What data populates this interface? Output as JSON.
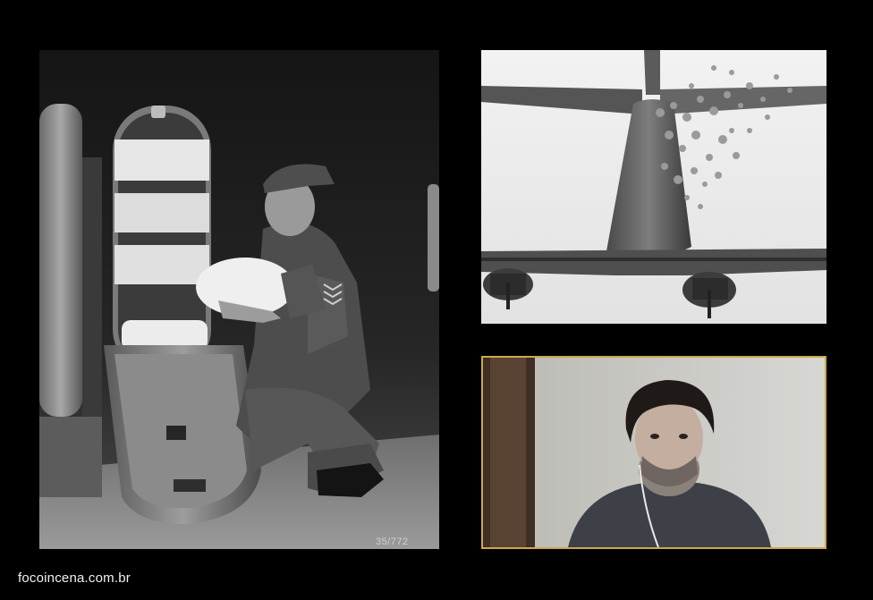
{
  "images": {
    "main_photo": {
      "negative_number": "35/772"
    },
    "plane_photo": {},
    "video_call": {}
  },
  "footer": {
    "site_url": "focoincena.com.br"
  },
  "colors": {
    "background": "#000000",
    "video_frame_border": "#c9a94e"
  }
}
